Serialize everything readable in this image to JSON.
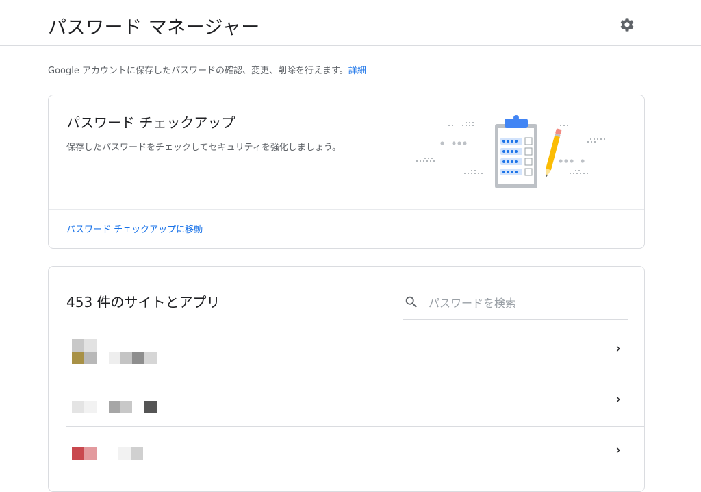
{
  "header": {
    "title": "パスワード マネージャー",
    "settings_icon": "gear-icon"
  },
  "intro": {
    "text": "Google アカウントに保存したパスワードの確認、変更、削除を行えます。",
    "link": "詳細"
  },
  "checkup": {
    "title": "パスワード チェックアップ",
    "description": "保存したパスワードをチェックしてセキュリティを強化しましょう。",
    "link": "パスワード チェックアップに移動",
    "illustration_icon": "clipboard-checklist-icon"
  },
  "sites": {
    "title": "453 件のサイトとアプリ",
    "search_placeholder": "パスワードを検索",
    "search_icon": "search-icon",
    "rows": [
      {
        "favicon_colors": [
          "#c8c8c8",
          "#e2e2e2",
          "#a89146",
          "#b8b8b8"
        ],
        "name_colors": [
          "#eeeeee",
          "#c4c4c4",
          "#8e8e8e",
          "#d6d6d6"
        ],
        "chevron": "chevron-right-icon"
      },
      {
        "favicon_colors": [
          "#ffffff",
          "#ffffff",
          "#e4e4e4",
          "#f2f2f2"
        ],
        "name_colors": [
          "#a6a6a6",
          "#c8c8c8",
          "#555555"
        ],
        "chevron": "chevron-right-icon"
      },
      {
        "favicon_colors": [
          "#ffffff",
          "#ffffff",
          "#c9484e",
          "#e39a9e"
        ],
        "name_colors": [
          "#f2f2f2",
          "#d0d0d0"
        ],
        "chevron": "chevron-right-icon"
      }
    ]
  },
  "colors": {
    "accent": "#1a73e8",
    "text_primary": "#202124",
    "text_secondary": "#5f6368",
    "border": "#dadce0"
  }
}
